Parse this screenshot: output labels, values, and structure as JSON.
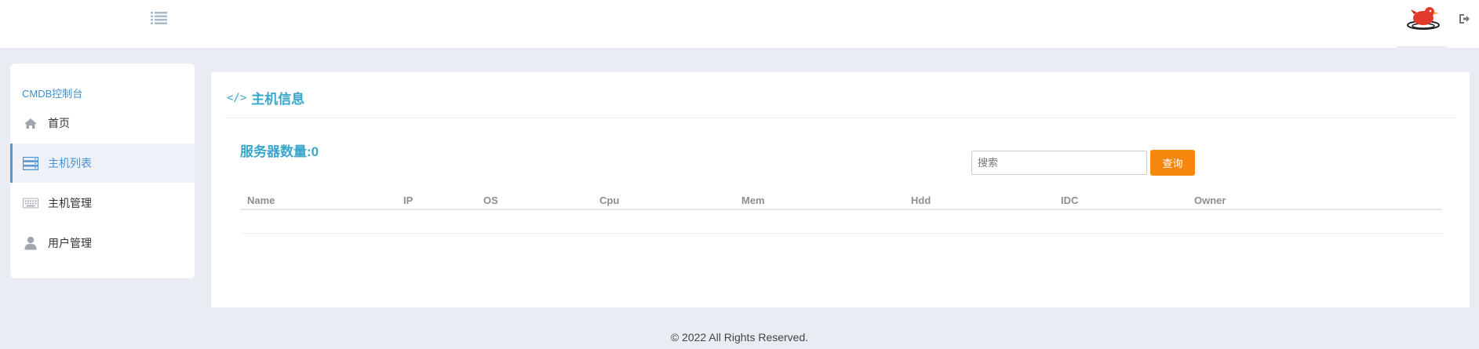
{
  "header": {
    "menu_icon": "list-icon",
    "avatar_icon": "bird-avatar",
    "logout_icon": "sign-out-icon"
  },
  "sidebar": {
    "title": "CMDB控制台",
    "items": [
      {
        "label": "首页",
        "icon": "home-icon",
        "active": false
      },
      {
        "label": "主机列表",
        "icon": "server-icon",
        "active": true
      },
      {
        "label": "主机管理",
        "icon": "keyboard-icon",
        "active": false
      },
      {
        "label": "用户管理",
        "icon": "user-icon",
        "active": false
      }
    ]
  },
  "main": {
    "title": "主机信息",
    "title_icon": "code-icon",
    "server_count": "服务器数量:0",
    "search": {
      "placeholder": "搜索",
      "value": ""
    },
    "search_button": "查询",
    "table": {
      "columns": [
        "Name",
        "IP",
        "OS",
        "Cpu",
        "Mem",
        "Hdd",
        "IDC",
        "Owner"
      ],
      "rows": []
    }
  },
  "footer": {
    "text": "© 2022 All Rights Reserved."
  },
  "colors": {
    "accent": "#3aa6c9",
    "nav_active": "#4a8fcf",
    "button": "#f7870f",
    "background": "#e9ecf3"
  }
}
